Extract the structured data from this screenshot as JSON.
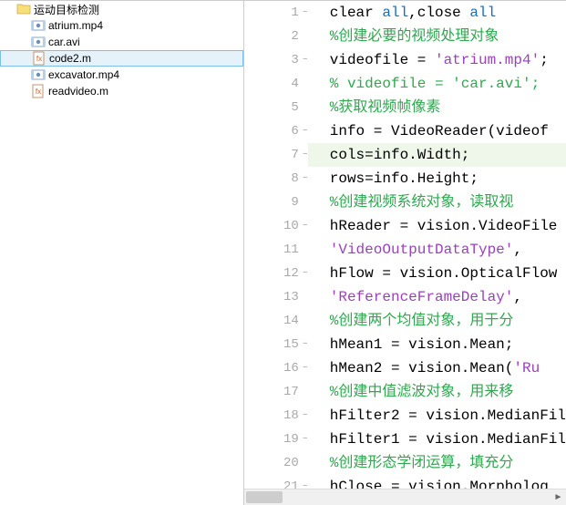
{
  "sidebar": {
    "folder": {
      "name": "运动目标检测"
    },
    "files": [
      {
        "name": "atrium.mp4",
        "type": "video"
      },
      {
        "name": "car.avi",
        "type": "video"
      },
      {
        "name": "code2.m",
        "type": "mfile",
        "selected": true
      },
      {
        "name": "excavator.mp4",
        "type": "video"
      },
      {
        "name": "readvideo.m",
        "type": "mfile"
      }
    ]
  },
  "editor": {
    "lines": [
      {
        "n": "1",
        "dash": true,
        "tokens": [
          {
            "t": "clear ",
            "c": ""
          },
          {
            "t": "all",
            "c": "kw"
          },
          {
            "t": ",close ",
            "c": ""
          },
          {
            "t": "all",
            "c": "kw"
          }
        ]
      },
      {
        "n": "2",
        "tokens": [
          {
            "t": "%创建必要的视频处理对象",
            "c": "com"
          }
        ]
      },
      {
        "n": "3",
        "dash": true,
        "tokens": [
          {
            "t": "videofile = ",
            "c": ""
          },
          {
            "t": "'atrium.mp4'",
            "c": "str"
          },
          {
            "t": ";",
            "c": ""
          }
        ]
      },
      {
        "n": "4",
        "tokens": [
          {
            "t": "% videofile = 'car.avi';",
            "c": "com"
          }
        ]
      },
      {
        "n": "5",
        "tokens": [
          {
            "t": "%获取视频帧像素",
            "c": "com"
          }
        ]
      },
      {
        "n": "6",
        "dash": true,
        "tokens": [
          {
            "t": "info = VideoReader(videof",
            "c": ""
          }
        ]
      },
      {
        "n": "7",
        "dash": true,
        "hl": true,
        "tokens": [
          {
            "t": "cols=info.Width;",
            "c": ""
          }
        ]
      },
      {
        "n": "8",
        "dash": true,
        "tokens": [
          {
            "t": "rows=info.Height;",
            "c": ""
          }
        ]
      },
      {
        "n": "9",
        "tokens": [
          {
            "t": "%创建视频系统对象，读取视",
            "c": "com"
          }
        ]
      },
      {
        "n": "10",
        "dash": true,
        "tokens": [
          {
            "t": "hReader = vision.VideoFile",
            "c": ""
          }
        ]
      },
      {
        "n": "11",
        "tokens": [
          {
            "t": "    ",
            "c": ""
          },
          {
            "t": "'VideoOutputDataType'",
            "c": "str"
          },
          {
            "t": ",",
            "c": ""
          }
        ]
      },
      {
        "n": "12",
        "dash": true,
        "tokens": [
          {
            "t": "hFlow = vision.OpticalFlow",
            "c": ""
          }
        ]
      },
      {
        "n": "13",
        "tokens": [
          {
            "t": "    ",
            "c": ""
          },
          {
            "t": "'ReferenceFrameDelay'",
            "c": "str"
          },
          {
            "t": ", ",
            "c": ""
          }
        ]
      },
      {
        "n": "14",
        "tokens": [
          {
            "t": "%创建两个均值对象，用于分",
            "c": "com"
          }
        ]
      },
      {
        "n": "15",
        "dash": true,
        "tokens": [
          {
            "t": "hMean1 = vision.Mean;",
            "c": ""
          }
        ]
      },
      {
        "n": "16",
        "dash": true,
        "tokens": [
          {
            "t": "hMean2 = vision.Mean(",
            "c": ""
          },
          {
            "t": "'Ru",
            "c": "str"
          }
        ]
      },
      {
        "n": "17",
        "tokens": [
          {
            "t": "%创建中值滤波对象，用来移",
            "c": "com"
          }
        ]
      },
      {
        "n": "18",
        "dash": true,
        "tokens": [
          {
            "t": "hFilter2 = vision.MedianFil",
            "c": ""
          }
        ]
      },
      {
        "n": "19",
        "dash": true,
        "tokens": [
          {
            "t": "hFilter1 = vision.MedianFil",
            "c": ""
          }
        ]
      },
      {
        "n": "20",
        "tokens": [
          {
            "t": "%创建形态学闭运算，填充分",
            "c": "com"
          }
        ]
      },
      {
        "n": "21",
        "dash": true,
        "tokens": [
          {
            "t": "hClose = vision.Morpholog",
            "c": ""
          }
        ]
      }
    ]
  }
}
